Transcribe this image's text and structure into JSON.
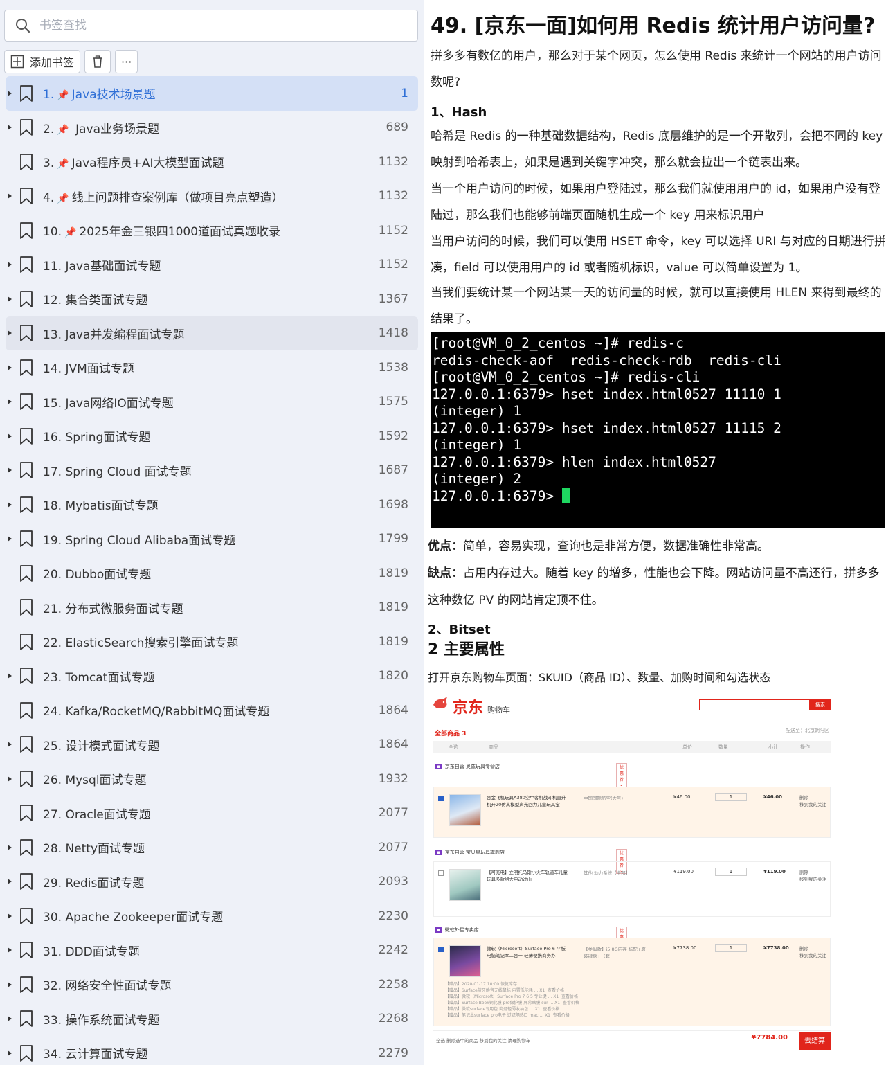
{
  "sidebar": {
    "search_placeholder": "书签查找",
    "toolbar": {
      "add_label": "添加书签",
      "more_label": "···"
    },
    "items": [
      {
        "num": "1.",
        "pinned": true,
        "title": "Java技术场景题",
        "page": "1",
        "expandable": true,
        "state": "selected"
      },
      {
        "num": "2.",
        "pinned": true,
        "title": " Java业务场景题",
        "page": "689",
        "expandable": true,
        "state": ""
      },
      {
        "num": "3.",
        "pinned": true,
        "title": "Java程序员+AI大模型面试题",
        "page": "1132",
        "expandable": false,
        "state": ""
      },
      {
        "num": "4.",
        "pinned": true,
        "title": "线上问题排查案例库（做项目亮点塑造）",
        "page": "1132",
        "expandable": true,
        "state": ""
      },
      {
        "num": "10.",
        "pinned": true,
        "title": "2025年金三银四1000道面试真题收录",
        "page": "1152",
        "expandable": false,
        "state": ""
      },
      {
        "num": "11.",
        "pinned": false,
        "title": "Java基础面试专题",
        "page": "1152",
        "expandable": true,
        "state": ""
      },
      {
        "num": "12.",
        "pinned": false,
        "title": "集合类面试专题",
        "page": "1367",
        "expandable": true,
        "state": ""
      },
      {
        "num": "13.",
        "pinned": false,
        "title": "Java并发编程面试专题",
        "page": "1418",
        "expandable": true,
        "state": "hover"
      },
      {
        "num": "14.",
        "pinned": false,
        "title": "JVM面试专题",
        "page": "1538",
        "expandable": true,
        "state": ""
      },
      {
        "num": "15.",
        "pinned": false,
        "title": "Java网络IO面试专题",
        "page": "1575",
        "expandable": true,
        "state": ""
      },
      {
        "num": "16.",
        "pinned": false,
        "title": "Spring面试专题",
        "page": "1592",
        "expandable": true,
        "state": ""
      },
      {
        "num": "17.",
        "pinned": false,
        "title": " Spring Cloud 面试专题",
        "page": "1687",
        "expandable": true,
        "state": ""
      },
      {
        "num": "18.",
        "pinned": false,
        "title": "Mybatis面试专题",
        "page": "1698",
        "expandable": true,
        "state": ""
      },
      {
        "num": "19.",
        "pinned": false,
        "title": "Spring Cloud Alibaba面试专题",
        "page": "1799",
        "expandable": true,
        "state": ""
      },
      {
        "num": "20.",
        "pinned": false,
        "title": "Dubbo面试专题",
        "page": "1819",
        "expandable": false,
        "state": ""
      },
      {
        "num": "21.",
        "pinned": false,
        "title": "分布式微服务面试专题",
        "page": "1819",
        "expandable": false,
        "state": ""
      },
      {
        "num": "22.",
        "pinned": false,
        "title": "ElasticSearch搜索引擎面试专题",
        "page": "1819",
        "expandable": false,
        "state": ""
      },
      {
        "num": "23.",
        "pinned": false,
        "title": "Tomcat面试专题",
        "page": "1820",
        "expandable": true,
        "state": ""
      },
      {
        "num": "24.",
        "pinned": false,
        "title": "Kafka/RocketMQ/RabbitMQ面试专题",
        "page": "1864",
        "expandable": false,
        "state": ""
      },
      {
        "num": "25.",
        "pinned": false,
        "title": "设计模式面试专题",
        "page": "1864",
        "expandable": true,
        "state": ""
      },
      {
        "num": "26.",
        "pinned": false,
        "title": "Mysql面试专题",
        "page": "1932",
        "expandable": true,
        "state": ""
      },
      {
        "num": "27.",
        "pinned": false,
        "title": "Oracle面试专题",
        "page": "2077",
        "expandable": false,
        "state": ""
      },
      {
        "num": "28.",
        "pinned": false,
        "title": "Netty面试专题",
        "page": "2077",
        "expandable": true,
        "state": ""
      },
      {
        "num": "29.",
        "pinned": false,
        "title": "Redis面试专题",
        "page": "2093",
        "expandable": true,
        "state": ""
      },
      {
        "num": "30.",
        "pinned": false,
        "title": "Apache Zookeeper面试专题",
        "page": "2230",
        "expandable": true,
        "state": ""
      },
      {
        "num": "31.",
        "pinned": false,
        "title": "DDD面试专题",
        "page": "2242",
        "expandable": true,
        "state": ""
      },
      {
        "num": "32.",
        "pinned": false,
        "title": "网络安全性面试专题",
        "page": "2258",
        "expandable": true,
        "state": ""
      },
      {
        "num": "33.",
        "pinned": false,
        "title": "操作系统面试专题",
        "page": "2268",
        "expandable": true,
        "state": ""
      },
      {
        "num": "34.",
        "pinned": false,
        "title": "云计算面试专题",
        "page": "2279",
        "expandable": true,
        "state": ""
      }
    ]
  },
  "doc": {
    "title": "49.  [京东一面]如何用  Redis  统计用户访问量?",
    "p1a": "拼多多有数亿的用户，那么对于某个网页，怎么使用 Redis 来统计一个网站的用户访问",
    "p1b": "数呢?",
    "s1_num": "1、",
    "s1_title": "Hash",
    "p2a": "哈希是 Redis 的一种基础数据结构，Redis 底层维护的是一个开散列，会把不同的 key",
    "p2b": "映射到哈希表上，如果是遇到关键字冲突，那么就会拉出一个链表出来。",
    "p3a": "当一个用户访问的时候，如果用户登陆过，那么我们就使用用户的 id，如果用户没有登",
    "p3b": "陆过，那么我们也能够前端页面随机生成一个 key 用来标识用户",
    "p4a": "当用户访问的时候，我们可以使用 HSET 命令，key 可以选择 URI 与对应的日期进行拼",
    "p4b": "凑，field 可以使用用户的 id 或者随机标识，value 可以简单设置为 1。",
    "p5a": "当我们要统计某一个网站某一天的访问量的时候，就可以直接使用 HLEN 来得到最终的",
    "p5b": "结果了。",
    "terminal": [
      "[root@VM_0_2_centos ~]# redis-c",
      "redis-check-aof  redis-check-rdb  redis-cli",
      "[root@VM_0_2_centos ~]# redis-cli",
      "127.0.0.1:6379> hset index.html0527 11110 1",
      "(integer) 1",
      "127.0.0.1:6379> hset index.html0527 11115 2",
      "(integer) 1",
      "127.0.0.1:6379> hlen index.html0527",
      "(integer) 2",
      "127.0.0.1:6379> "
    ],
    "pros_label": "优点",
    "pros_text": "：简单，容易实现，查询也是非常方便，数据准确性非常高。",
    "cons_label": "缺点",
    "cons_text": "：占用内存过大。随着 key 的增多，性能也会下降。网站访问量不高还行，拼多多",
    "cons_text2": "这种数亿 PV 的网站肯定顶不住。",
    "s2_num": "2、",
    "s2_title": "Bitset",
    "h2": "2  主要属性",
    "p6": "打开京东购物车页面：SKUID（商品 ID）、数量、加购时间和勾选状态"
  },
  "cart": {
    "logo": "京东",
    "logo_sub": "购物车",
    "search_btn": "搜索",
    "all_label": "全部商品 3",
    "addr": "配送至：北京朝阳区",
    "headers": [
      "全选",
      "商品",
      "单价",
      "数量",
      "小计",
      "操作"
    ],
    "shops": [
      "京东自营 奥兹玩具专营店",
      "京东自营 宝贝星玩具旗舰店",
      "微软外星专卖店"
    ],
    "coupon": "优惠券 ⌄",
    "items": [
      {
        "name": "合金飞机玩具A380空中客机战斗机直升机开20仿真模型声光回力儿童玩具宝",
        "spec": "中国国际航空(大号)",
        "price": "¥46.00",
        "qty": "1",
        "sum": "¥46.00",
        "ops": "删除\n移到我的关注"
      },
      {
        "name": "【可充电】立明托马斯小火车轨道车儿童玩具多款组大电动过山",
        "spec": "其他 动力系统【全部】",
        "price": "¥119.00",
        "qty": "1",
        "sum": "¥119.00",
        "ops": "删除\n移到我的关注"
      },
      {
        "name": "微软（Microsoft）Surface Pro 6 平板电脑笔记本二合一 轻薄便携商务办",
        "spec": "【类似款】i5 8G内存 标配+原装键盘+【套",
        "price": "¥7738.00",
        "qty": "1",
        "sum": "¥7738.00",
        "ops": "删除\n移到我的关注"
      }
    ],
    "gift_lines": "【赠品】2020-01-17 10:00 恢复库存\n【赠品】Surface蓝牙静音无线鼠标 内置低能耗 ... X1  查看价格\n【赠品】微软（Microsoft）Surface Pro 7 6 5 专业键 ... X1  查看价格\n【赠品】Surface Book钢化膜 pro保护膜 屏幕贴膜 sur ... X1  查看价格\n【赠品】微软surface专用包 商务轻薄收纳包 ... X1  查看价格\n【赠品】笔记本surface pro电子 过滤隔热口 mac ... X1  查看价格",
    "foot_left": "全选  删除选中的商品  移到我的关注  清理购物车",
    "total": "¥7784.00",
    "settle": "去结算"
  },
  "colors": {
    "selected_bg": "#d4e0f6",
    "selected_text": "#2f6fd6",
    "pin": "#e0262f",
    "jd_red": "#e1251b",
    "terminal_cursor": "#1ed760"
  }
}
